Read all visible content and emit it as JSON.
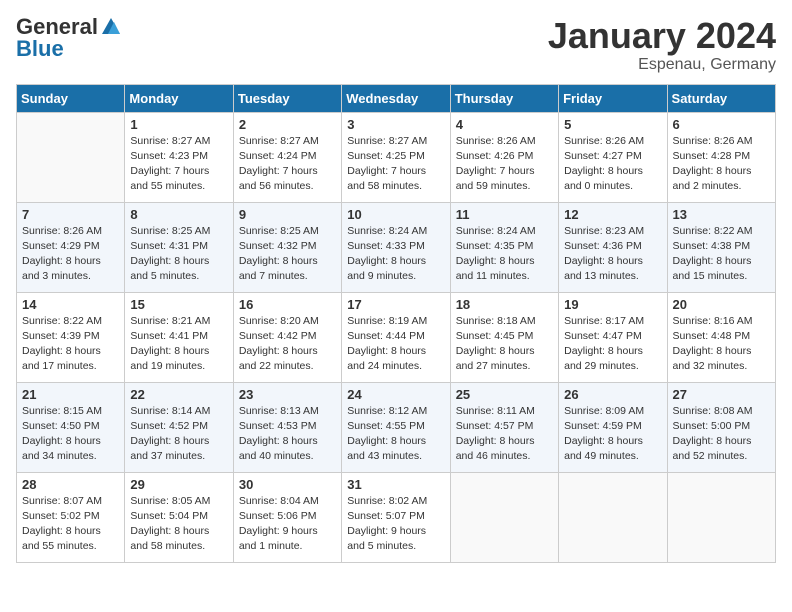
{
  "header": {
    "logo_general": "General",
    "logo_blue": "Blue",
    "month_title": "January 2024",
    "location": "Espenau, Germany"
  },
  "days_of_week": [
    "Sunday",
    "Monday",
    "Tuesday",
    "Wednesday",
    "Thursday",
    "Friday",
    "Saturday"
  ],
  "weeks": [
    [
      {
        "day": "",
        "info": ""
      },
      {
        "day": "1",
        "info": "Sunrise: 8:27 AM\nSunset: 4:23 PM\nDaylight: 7 hours\nand 55 minutes."
      },
      {
        "day": "2",
        "info": "Sunrise: 8:27 AM\nSunset: 4:24 PM\nDaylight: 7 hours\nand 56 minutes."
      },
      {
        "day": "3",
        "info": "Sunrise: 8:27 AM\nSunset: 4:25 PM\nDaylight: 7 hours\nand 58 minutes."
      },
      {
        "day": "4",
        "info": "Sunrise: 8:26 AM\nSunset: 4:26 PM\nDaylight: 7 hours\nand 59 minutes."
      },
      {
        "day": "5",
        "info": "Sunrise: 8:26 AM\nSunset: 4:27 PM\nDaylight: 8 hours\nand 0 minutes."
      },
      {
        "day": "6",
        "info": "Sunrise: 8:26 AM\nSunset: 4:28 PM\nDaylight: 8 hours\nand 2 minutes."
      }
    ],
    [
      {
        "day": "7",
        "info": "Sunrise: 8:26 AM\nSunset: 4:29 PM\nDaylight: 8 hours\nand 3 minutes."
      },
      {
        "day": "8",
        "info": "Sunrise: 8:25 AM\nSunset: 4:31 PM\nDaylight: 8 hours\nand 5 minutes."
      },
      {
        "day": "9",
        "info": "Sunrise: 8:25 AM\nSunset: 4:32 PM\nDaylight: 8 hours\nand 7 minutes."
      },
      {
        "day": "10",
        "info": "Sunrise: 8:24 AM\nSunset: 4:33 PM\nDaylight: 8 hours\nand 9 minutes."
      },
      {
        "day": "11",
        "info": "Sunrise: 8:24 AM\nSunset: 4:35 PM\nDaylight: 8 hours\nand 11 minutes."
      },
      {
        "day": "12",
        "info": "Sunrise: 8:23 AM\nSunset: 4:36 PM\nDaylight: 8 hours\nand 13 minutes."
      },
      {
        "day": "13",
        "info": "Sunrise: 8:22 AM\nSunset: 4:38 PM\nDaylight: 8 hours\nand 15 minutes."
      }
    ],
    [
      {
        "day": "14",
        "info": "Sunrise: 8:22 AM\nSunset: 4:39 PM\nDaylight: 8 hours\nand 17 minutes."
      },
      {
        "day": "15",
        "info": "Sunrise: 8:21 AM\nSunset: 4:41 PM\nDaylight: 8 hours\nand 19 minutes."
      },
      {
        "day": "16",
        "info": "Sunrise: 8:20 AM\nSunset: 4:42 PM\nDaylight: 8 hours\nand 22 minutes."
      },
      {
        "day": "17",
        "info": "Sunrise: 8:19 AM\nSunset: 4:44 PM\nDaylight: 8 hours\nand 24 minutes."
      },
      {
        "day": "18",
        "info": "Sunrise: 8:18 AM\nSunset: 4:45 PM\nDaylight: 8 hours\nand 27 minutes."
      },
      {
        "day": "19",
        "info": "Sunrise: 8:17 AM\nSunset: 4:47 PM\nDaylight: 8 hours\nand 29 minutes."
      },
      {
        "day": "20",
        "info": "Sunrise: 8:16 AM\nSunset: 4:48 PM\nDaylight: 8 hours\nand 32 minutes."
      }
    ],
    [
      {
        "day": "21",
        "info": "Sunrise: 8:15 AM\nSunset: 4:50 PM\nDaylight: 8 hours\nand 34 minutes."
      },
      {
        "day": "22",
        "info": "Sunrise: 8:14 AM\nSunset: 4:52 PM\nDaylight: 8 hours\nand 37 minutes."
      },
      {
        "day": "23",
        "info": "Sunrise: 8:13 AM\nSunset: 4:53 PM\nDaylight: 8 hours\nand 40 minutes."
      },
      {
        "day": "24",
        "info": "Sunrise: 8:12 AM\nSunset: 4:55 PM\nDaylight: 8 hours\nand 43 minutes."
      },
      {
        "day": "25",
        "info": "Sunrise: 8:11 AM\nSunset: 4:57 PM\nDaylight: 8 hours\nand 46 minutes."
      },
      {
        "day": "26",
        "info": "Sunrise: 8:09 AM\nSunset: 4:59 PM\nDaylight: 8 hours\nand 49 minutes."
      },
      {
        "day": "27",
        "info": "Sunrise: 8:08 AM\nSunset: 5:00 PM\nDaylight: 8 hours\nand 52 minutes."
      }
    ],
    [
      {
        "day": "28",
        "info": "Sunrise: 8:07 AM\nSunset: 5:02 PM\nDaylight: 8 hours\nand 55 minutes."
      },
      {
        "day": "29",
        "info": "Sunrise: 8:05 AM\nSunset: 5:04 PM\nDaylight: 8 hours\nand 58 minutes."
      },
      {
        "day": "30",
        "info": "Sunrise: 8:04 AM\nSunset: 5:06 PM\nDaylight: 9 hours\nand 1 minute."
      },
      {
        "day": "31",
        "info": "Sunrise: 8:02 AM\nSunset: 5:07 PM\nDaylight: 9 hours\nand 5 minutes."
      },
      {
        "day": "",
        "info": ""
      },
      {
        "day": "",
        "info": ""
      },
      {
        "day": "",
        "info": ""
      }
    ]
  ]
}
